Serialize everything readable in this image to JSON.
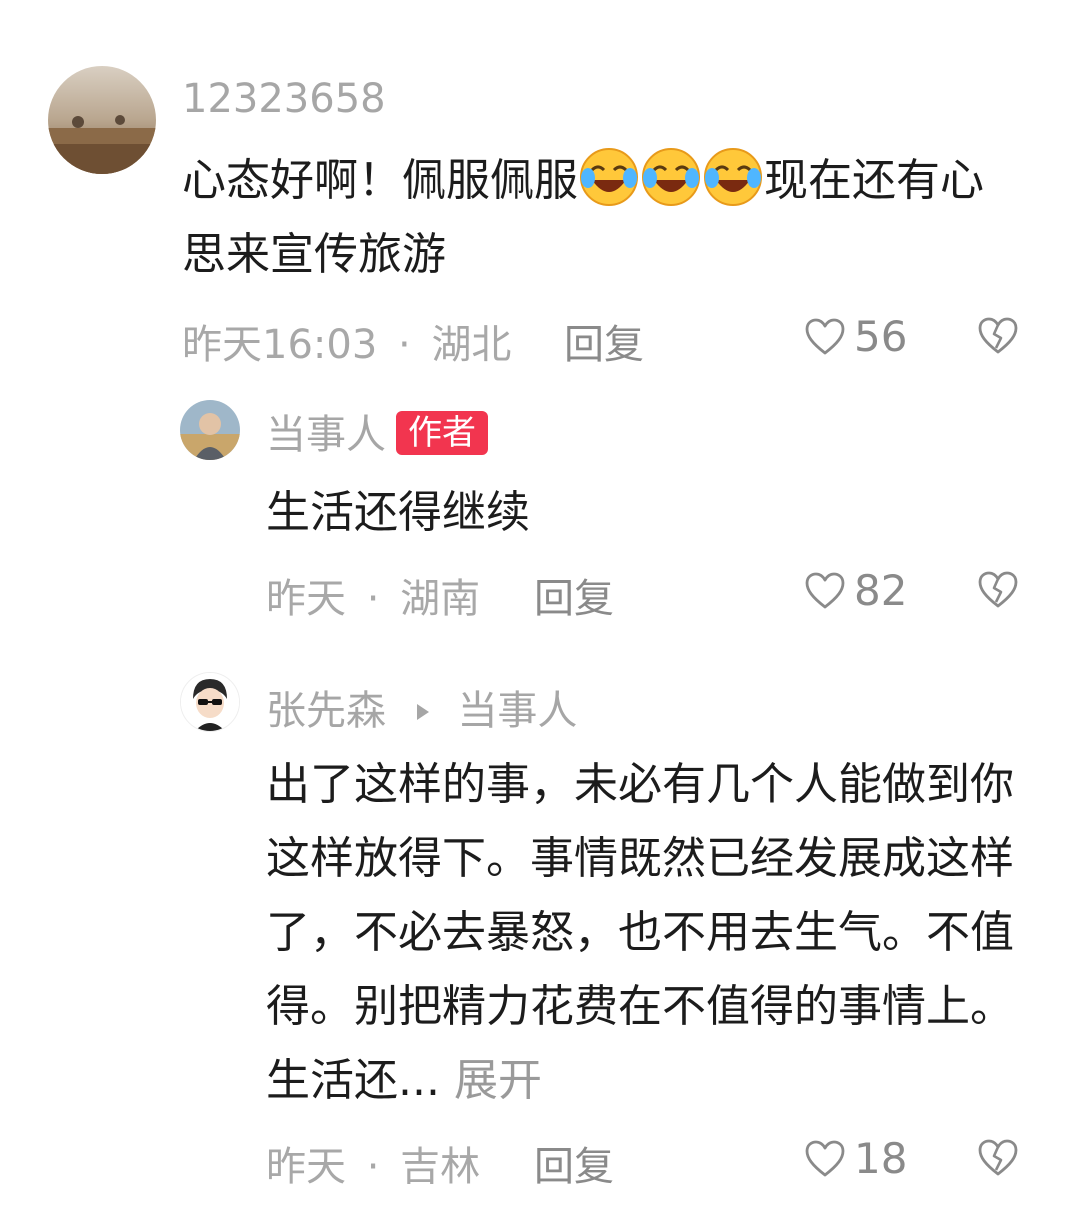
{
  "top_partial_text": "",
  "comments": [
    {
      "username": "12323658",
      "text_before_emoji": "心态好啊！佩服佩服",
      "emoji_name": "laughing-tears-emoji",
      "emoji_count": 3,
      "text_after_emoji": "现在还有心思来宣传旅游",
      "time": "昨天16:03",
      "separator": "·",
      "location": "湖北",
      "reply_label": "回复",
      "likes": "56"
    }
  ],
  "replies": [
    {
      "username": "当事人",
      "badge": "作者",
      "text": "生活还得继续",
      "time": "昨天",
      "separator": "·",
      "location": "湖南",
      "reply_label": "回复",
      "likes": "82"
    },
    {
      "username": "张先森",
      "reply_to": "当事人",
      "text": "出了这样的事，未必有几个人能做到你这样放得下。事情既然已经发展成这样了，不必去暴怒，也不用去生气。不值得。别把精力花费在不值得的事情上。生活还...",
      "expand_label": "展开",
      "time": "昨天",
      "separator": "·",
      "location": "吉林",
      "reply_label": "回复",
      "likes": "18"
    }
  ],
  "icons": {
    "like": "heart-outline-icon",
    "dislike": "broken-heart-icon",
    "reply_arrow": "triangle-right-icon"
  },
  "colors": {
    "badge_bg": "#f2354f",
    "meta_text": "#a8a8a8",
    "body_text": "#1c1c1c"
  }
}
